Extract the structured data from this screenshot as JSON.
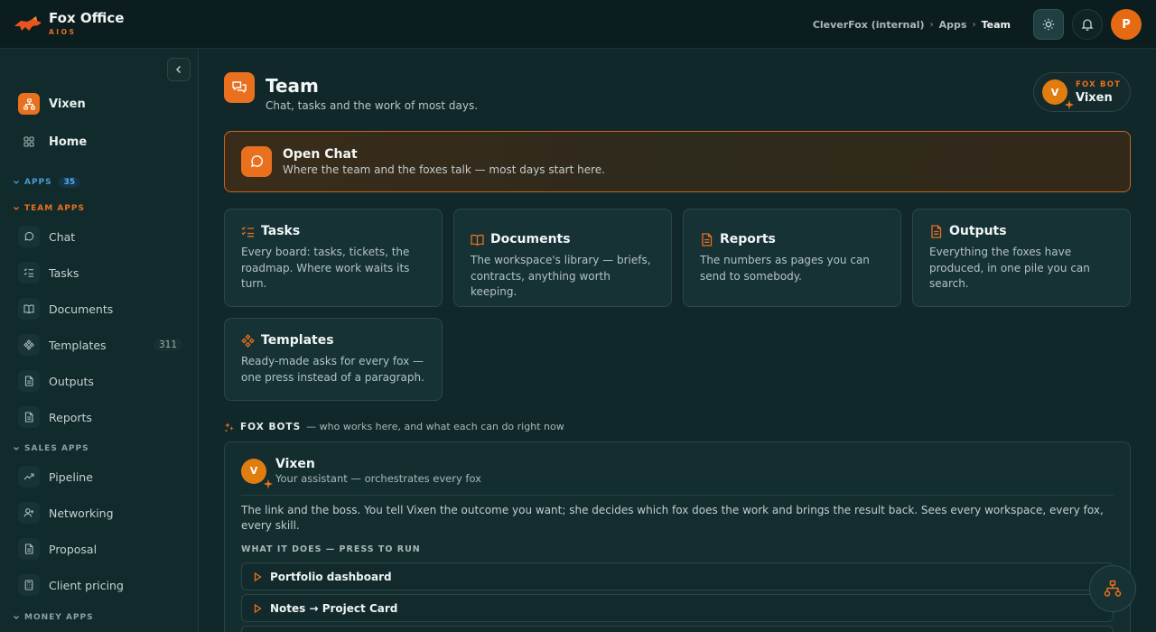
{
  "brand": {
    "name": "Fox Office",
    "sub": "AIOS"
  },
  "breadcrumb": {
    "items": [
      "CleverFox (internal)",
      "Apps",
      "Team"
    ]
  },
  "user": {
    "initial": "P"
  },
  "sidebar": {
    "workspace": {
      "label": "Vixen"
    },
    "home": {
      "label": "Home"
    },
    "apps_section": {
      "label": "APPS",
      "count": "35"
    },
    "team_section": {
      "label": "TEAM APPS"
    },
    "team_items": [
      {
        "label": "Chat",
        "icon": "chat-icon"
      },
      {
        "label": "Tasks",
        "icon": "tasks-icon"
      },
      {
        "label": "Documents",
        "icon": "book-icon"
      },
      {
        "label": "Templates",
        "icon": "templates-icon",
        "count": "311"
      },
      {
        "label": "Outputs",
        "icon": "file-icon"
      },
      {
        "label": "Reports",
        "icon": "file-icon"
      }
    ],
    "sales_section": {
      "label": "SALES APPS"
    },
    "sales_items": [
      {
        "label": "Pipeline",
        "icon": "trend-icon"
      },
      {
        "label": "Networking",
        "icon": "user-plus-icon"
      },
      {
        "label": "Proposal",
        "icon": "file-icon"
      },
      {
        "label": "Client pricing",
        "icon": "calculator-icon"
      }
    ],
    "money_section": {
      "label": "MONEY APPS"
    }
  },
  "page": {
    "title": "Team",
    "subtitle": "Chat, tasks and the work of most days."
  },
  "foxbot_chip": {
    "tag": "FOX BOT",
    "name": "Vixen",
    "initial": "V"
  },
  "open_chat": {
    "title": "Open Chat",
    "subtitle": "Where the team and the foxes talk — most days start here."
  },
  "cards": [
    {
      "title": "Tasks",
      "desc": "Every board: tasks, tickets, the roadmap. Where work waits its turn."
    },
    {
      "title": "Documents",
      "desc": "The workspace's library — briefs, contracts, anything worth keeping."
    },
    {
      "title": "Reports",
      "desc": "The numbers as pages you can send to somebody."
    },
    {
      "title": "Outputs",
      "desc": "Everything the foxes have produced, in one pile you can search."
    },
    {
      "title": "Templates",
      "desc": "Ready-made asks for every fox — one press instead of a paragraph."
    }
  ],
  "foxbots": {
    "label": "FOX BOTS",
    "desc": "— who works here, and what each can do right now",
    "bot": {
      "initial": "V",
      "name": "Vixen",
      "role": "Your assistant — orchestrates every fox",
      "desc": "The link and the boss. You tell Vixen the outcome you want; she decides which fox does the work and brings the result back. Sees every workspace, every fox, every skill.",
      "section": "WHAT IT DOES — PRESS TO RUN",
      "actions": [
        "Portfolio dashboard",
        "Notes → Project Card"
      ]
    }
  },
  "colors": {
    "accent": "#e8701e",
    "background": "#11282a",
    "card": "#163234"
  }
}
